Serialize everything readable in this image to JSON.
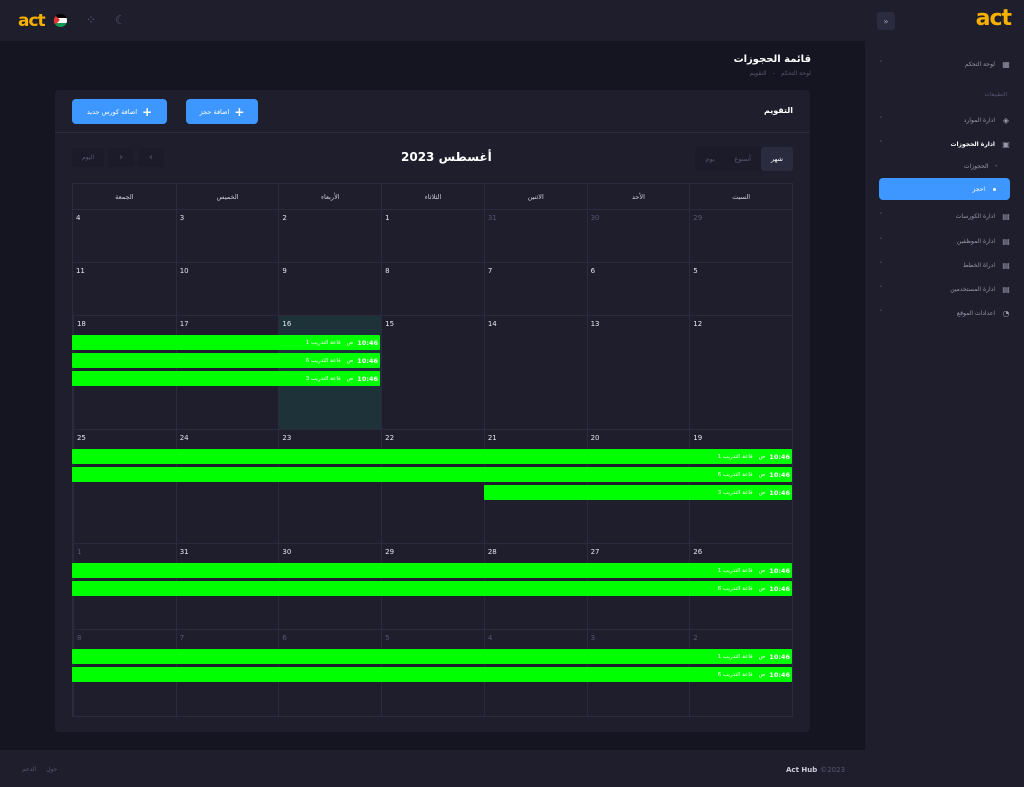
{
  "colors": {
    "accent": "#3e97ff",
    "event": "#00ff00",
    "logo": "#f6b100"
  },
  "topbar": {
    "logo": "act",
    "flag": "palestine-flag",
    "icons": [
      "dots-icon",
      "moon-icon"
    ]
  },
  "page": {
    "title": "قائمة الحجوزات",
    "breadcrumb": [
      "لوحة التحكم",
      "-",
      "التقويم"
    ]
  },
  "card": {
    "title": "التقويم",
    "add_booking_button": "اضافة حجز",
    "add_course_button": "اضافة كورس جديد"
  },
  "calendar": {
    "month_title": "أغسطس 2023",
    "today_button": "اليوم",
    "prev_icon": "‹",
    "next_icon": "›",
    "views": [
      "شهر",
      "أسبوع",
      "يوم"
    ],
    "active_view": "شهر",
    "weekdays": [
      "السبت",
      "الأحد",
      "الاثنين",
      "الثلاثاء",
      "الأربعاء",
      "الخميس",
      "الجمعة"
    ],
    "weeks": [
      {
        "days": [
          {
            "n": "29",
            "o": true
          },
          {
            "n": "30",
            "o": true
          },
          {
            "n": "31",
            "o": true
          },
          {
            "n": "1"
          },
          {
            "n": "2"
          },
          {
            "n": "3"
          },
          {
            "n": "4"
          }
        ],
        "events": []
      },
      {
        "days": [
          {
            "n": "5"
          },
          {
            "n": "6"
          },
          {
            "n": "7"
          },
          {
            "n": "8"
          },
          {
            "n": "9"
          },
          {
            "n": "10"
          },
          {
            "n": "11"
          }
        ],
        "events": []
      },
      {
        "days": [
          {
            "n": "12"
          },
          {
            "n": "13"
          },
          {
            "n": "14"
          },
          {
            "n": "15"
          },
          {
            "n": "16",
            "today": true
          },
          {
            "n": "17"
          },
          {
            "n": "18"
          }
        ],
        "events": [
          {
            "time": "10:46",
            "ampm": "ص",
            "title": "قاعة التدريب 1",
            "start": 4,
            "end": 6
          },
          {
            "time": "10:46",
            "ampm": "ص",
            "title": "قاعة التدريب 6",
            "start": 4,
            "end": 6
          },
          {
            "time": "10:46",
            "ampm": "ص",
            "title": "قاعة التدريب 3",
            "start": 4,
            "end": 6
          }
        ]
      },
      {
        "days": [
          {
            "n": "19"
          },
          {
            "n": "20"
          },
          {
            "n": "21"
          },
          {
            "n": "22"
          },
          {
            "n": "23"
          },
          {
            "n": "24"
          },
          {
            "n": "25"
          }
        ],
        "events": [
          {
            "time": "10:46",
            "ampm": "ص",
            "title": "قاعة التدريب 1",
            "start": 0,
            "end": 6
          },
          {
            "time": "10:46",
            "ampm": "ص",
            "title": "قاعة التدريب 6",
            "start": 0,
            "end": 6
          },
          {
            "time": "10:46",
            "ampm": "ص",
            "title": "قاعة التدريب 3",
            "start": 0,
            "end": 2
          }
        ]
      },
      {
        "days": [
          {
            "n": "26"
          },
          {
            "n": "27"
          },
          {
            "n": "28"
          },
          {
            "n": "29"
          },
          {
            "n": "30"
          },
          {
            "n": "31"
          },
          {
            "n": "1",
            "o": true
          }
        ],
        "events": [
          {
            "time": "10:46",
            "ampm": "ص",
            "title": "قاعة التدريب 1",
            "start": 0,
            "end": 6
          },
          {
            "time": "10:46",
            "ampm": "ص",
            "title": "قاعة التدريب 6",
            "start": 0,
            "end": 6
          }
        ]
      },
      {
        "days": [
          {
            "n": "2",
            "o": true
          },
          {
            "n": "3",
            "o": true
          },
          {
            "n": "4",
            "o": true
          },
          {
            "n": "5",
            "o": true
          },
          {
            "n": "6",
            "o": true
          },
          {
            "n": "7",
            "o": true
          },
          {
            "n": "8",
            "o": true
          }
        ],
        "events": [
          {
            "time": "10:46",
            "ampm": "ص",
            "title": "قاعة التدريب 1",
            "start": 0,
            "end": 6
          },
          {
            "time": "10:46",
            "ampm": "ص",
            "title": "قاعة التدريب 6",
            "start": 0,
            "end": 6
          }
        ]
      }
    ]
  },
  "footer": {
    "brand": "Act Hub",
    "year": "©2023",
    "links": [
      "الدعم",
      "حول"
    ]
  },
  "sidebar": {
    "logo": "act",
    "collapse_icon": "»",
    "section_label": "التطبيقات",
    "items": [
      {
        "label": "لوحة التحكم",
        "icon": "grid-icon",
        "glyph": "▦",
        "bold": false
      },
      {
        "label": "ادارة الموارد",
        "icon": "layers-icon",
        "glyph": "◈",
        "bold": false
      },
      {
        "label": "ادارة الحجوزات",
        "icon": "calendar-icon",
        "glyph": "▣",
        "bold": true
      },
      {
        "label": "ادارة الكورسات",
        "icon": "document-icon",
        "glyph": "▤",
        "bold": false
      },
      {
        "label": "ادارة الموظفين",
        "icon": "document-icon",
        "glyph": "▤",
        "bold": false
      },
      {
        "label": "ادراة الخطط",
        "icon": "document-icon",
        "glyph": "▤",
        "bold": false
      },
      {
        "label": "ادارة المستخدمين",
        "icon": "document-icon",
        "glyph": "▤",
        "bold": false
      },
      {
        "label": "اعدادات الموقع",
        "icon": "spinner-icon",
        "glyph": "◔",
        "bold": false
      }
    ],
    "sub_items": [
      "الحجوزات",
      "احجز"
    ]
  }
}
